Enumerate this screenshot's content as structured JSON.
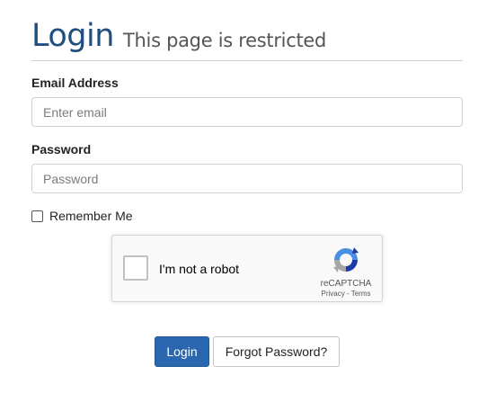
{
  "header": {
    "title": "Login",
    "subtitle": "This page is restricted"
  },
  "form": {
    "email": {
      "label": "Email Address",
      "placeholder": "Enter email",
      "value": ""
    },
    "password": {
      "label": "Password",
      "placeholder": "Password",
      "value": ""
    },
    "remember_label": "Remember Me",
    "remember_checked": false
  },
  "captcha": {
    "text": "I'm not a robot",
    "brand": "reCAPTCHA",
    "links": "Privacy - Terms",
    "checked": false,
    "icon": "recaptcha-logo-icon"
  },
  "buttons": {
    "login": "Login",
    "forgot": "Forgot Password?"
  },
  "colors": {
    "title": "#1f4f80",
    "primary_button": "#2b67ae"
  }
}
